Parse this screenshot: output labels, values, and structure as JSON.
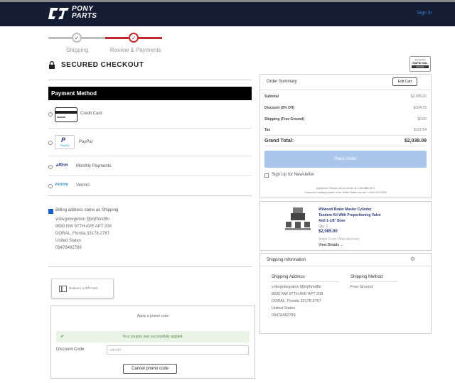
{
  "header": {
    "brand_line1": "PONY",
    "brand_line2": "PARTS",
    "sign_in": "Sign In"
  },
  "steps": [
    {
      "label": "Shipping",
      "state": "done"
    },
    {
      "label": "Review & Payments",
      "state": "active"
    }
  ],
  "colors": {
    "accent": "#c0292f",
    "navy": "#141d33",
    "link": "#3b7fd4",
    "place_order": "#a9c6ea",
    "success_bg": "#e9f3e6"
  },
  "page_title": "SECURED CHECKOUT",
  "badge": {
    "line1": "Secured by",
    "line2": "RAPID SSL",
    "line3": "$10,000"
  },
  "payment": {
    "header": "Payment Method",
    "options": [
      {
        "label": "Credit Card",
        "icon": "credit-card-icon"
      },
      {
        "label": "PayPal",
        "icon": "paypal-icon",
        "icon_text": "PayPal"
      },
      {
        "label": "Monthly Payments",
        "icon": "affirm-icon",
        "icon_text": "affirm"
      },
      {
        "label": "Venmo",
        "icon": "venmo-icon",
        "icon_text": "venmo"
      }
    ],
    "billing_checkbox_label": "Billing address same as Shipping",
    "billing_address": [
      "vnbvgnbvgnbvn fjfjmjfhmdfhr",
      "8930 NW 97TH AVE APT 208",
      "DORAL, Florida 33178-2767",
      "United States",
      "09478482789"
    ]
  },
  "gift_card": {
    "label": "Redeem a Gift Card"
  },
  "promo": {
    "title": "Apply a promo code",
    "success_message": "Your coupon was successfully applied.",
    "discount_label": "Discount Code",
    "discount_value": "sdrs94",
    "cancel_button": "Cancel promo code"
  },
  "order_summary": {
    "title": "Order Summary",
    "edit_cart": "Edit Cart",
    "rows": [
      {
        "label": "Subtotal",
        "value": "$2,095.00"
      },
      {
        "label": "Discount (5% Off)",
        "value": "-$104.75"
      },
      {
        "label": "Shipping (Free Ground)",
        "value": "$0.00"
      },
      {
        "label": "Tax",
        "value": "$137.54"
      }
    ],
    "grand_total_label": "Grand Total:",
    "grand_total_value": "$2,038.09",
    "place_order": "Place Order",
    "newsletter": "Sign Up for Newsletter",
    "help_line1": "Questions? Please call us toll free at 1-800-888-6471",
    "help_line2": "Customers residing outside of the United States can call +1-954-XXX-9250"
  },
  "cart_item": {
    "name_line1": "Wilwood Brake Master Cylinder",
    "name_line2": "Tandem Kit With Proportioning Valve",
    "name_line3": "And 1-1/8\" Bore",
    "qty": "Qty: 1",
    "price": "$2,085.00",
    "ships_from": "Ships From: Manufacturer",
    "view_details": "View Details"
  },
  "shipping_info": {
    "title": "Shipping Information",
    "address_header": "Shipping Address",
    "address_lines": [
      "vnbvgnbvgnbvn fjfjmjfhmdfhr",
      "8930 NW 97TH AVE APT 208",
      "DORAL, Florida 33178-2767",
      "United States",
      "09478482789"
    ],
    "method_header": "Shipping Method",
    "method_value": "Free Ground"
  }
}
